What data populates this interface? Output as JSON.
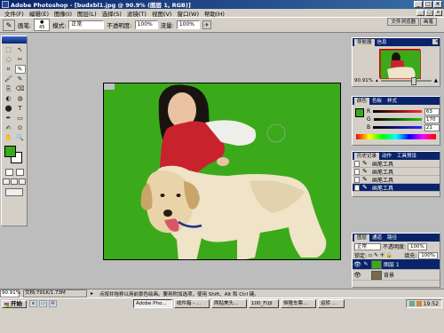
{
  "window": {
    "title": "Adobe Photoshop - [budxbl1.jpg @ 90.9% (图层 1, RGB)]",
    "buttons": [
      "_",
      "□",
      "×"
    ]
  },
  "menu": {
    "items": [
      "文件(F)",
      "编辑(E)",
      "图像(I)",
      "图层(L)",
      "选择(S)",
      "滤镜(T)",
      "视图(V)",
      "窗口(W)",
      "帮助(H)"
    ],
    "doc_buttons": [
      "_",
      "□",
      "×"
    ]
  },
  "options": {
    "brush_label": "画笔:",
    "brush_size": "45",
    "mode_label": "模式:",
    "mode_value": "正常",
    "opacity_label": "不透明度:",
    "opacity_value": "100%",
    "flow_label": "流量:",
    "flow_value": "100%",
    "palette_tabs": [
      "文件浏览器",
      "画笔"
    ]
  },
  "toolbox": {
    "tools": [
      "⬚",
      "↖",
      "◌",
      "✂",
      "⌗",
      "✎",
      "🖌",
      "✎",
      "⎘",
      "⌫",
      "◐",
      "◍",
      "⬤",
      "T",
      "✒",
      "▭",
      "✍",
      "⊙",
      "✋",
      "🔍"
    ],
    "active_index": 5,
    "foreground_color": "#3aaa1a",
    "background_color": "#ffffff"
  },
  "navigator": {
    "tabs": [
      "导航器",
      "信息"
    ],
    "zoom": "90.91%"
  },
  "color_panel": {
    "tabs": [
      "颜色",
      "色板",
      "样式"
    ],
    "channels": [
      {
        "label": "R",
        "value": "63",
        "color": "#ff2a2a"
      },
      {
        "label": "G",
        "value": "170",
        "color": "#22c022"
      },
      {
        "label": "B",
        "value": "21",
        "color": "#2a2aff"
      }
    ]
  },
  "history": {
    "tabs": [
      "历史记录",
      "动作",
      "工具预设"
    ],
    "items": [
      "画笔工具",
      "画笔工具",
      "画笔工具",
      "画笔工具"
    ],
    "selected_index": 3
  },
  "layers": {
    "tabs": [
      "图层",
      "通道",
      "路径"
    ],
    "blend_mode": "正常",
    "opacity_label": "不透明度:",
    "opacity_value": "100%",
    "lock_label": "锁定:",
    "fill_label": "填充:",
    "fill_value": "100%",
    "items": [
      {
        "name": "图层 1",
        "selected": true
      },
      {
        "name": "背景",
        "selected": false
      }
    ]
  },
  "status": {
    "zoom": "90.91%",
    "doc_info": "文档:791K/1.73M",
    "tip": "点按并拖移以用前景色绘画。要用附加选项，使用 Shift、Alt 和 Ctrl 键。"
  },
  "taskbar": {
    "start_label": "开始",
    "tasks": [
      {
        "label": "Adobe Pho...",
        "active": true
      },
      {
        "label": "收件箱 - ...",
        "active": false
      },
      {
        "label": "两贴美头...",
        "active": false
      },
      {
        "label": "100_FUJI",
        "active": false
      },
      {
        "label": "恒隆车票...",
        "active": false
      },
      {
        "label": "运转 ...",
        "active": false
      }
    ],
    "time": "19:52"
  }
}
